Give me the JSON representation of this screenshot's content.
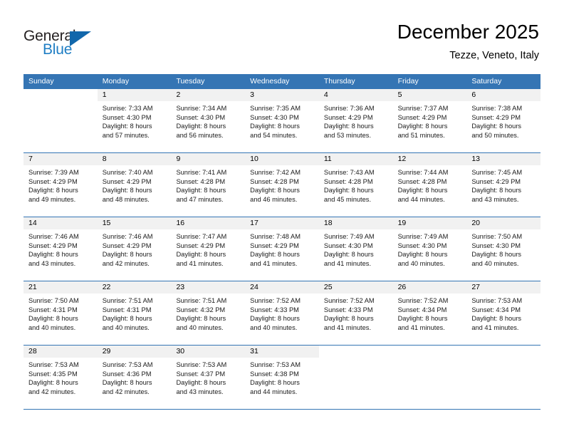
{
  "brand": {
    "name_top": "General",
    "name_bottom": "Blue",
    "color_black": "#231f20",
    "color_blue": "#1f7ec4",
    "triangle_color": "#1267ab"
  },
  "header": {
    "month_title": "December 2025",
    "location": "Tezze, Veneto, Italy"
  },
  "calendar": {
    "accent_color": "#3575b4",
    "daynum_band_color": "#f1f1f1",
    "weekdays": [
      "Sunday",
      "Monday",
      "Tuesday",
      "Wednesday",
      "Thursday",
      "Friday",
      "Saturday"
    ],
    "weeks": [
      [
        {
          "day": "",
          "lines": [
            "",
            "",
            "",
            ""
          ]
        },
        {
          "day": "1",
          "lines": [
            "Sunrise: 7:33 AM",
            "Sunset: 4:30 PM",
            "Daylight: 8 hours",
            "and 57 minutes."
          ]
        },
        {
          "day": "2",
          "lines": [
            "Sunrise: 7:34 AM",
            "Sunset: 4:30 PM",
            "Daylight: 8 hours",
            "and 56 minutes."
          ]
        },
        {
          "day": "3",
          "lines": [
            "Sunrise: 7:35 AM",
            "Sunset: 4:30 PM",
            "Daylight: 8 hours",
            "and 54 minutes."
          ]
        },
        {
          "day": "4",
          "lines": [
            "Sunrise: 7:36 AM",
            "Sunset: 4:29 PM",
            "Daylight: 8 hours",
            "and 53 minutes."
          ]
        },
        {
          "day": "5",
          "lines": [
            "Sunrise: 7:37 AM",
            "Sunset: 4:29 PM",
            "Daylight: 8 hours",
            "and 51 minutes."
          ]
        },
        {
          "day": "6",
          "lines": [
            "Sunrise: 7:38 AM",
            "Sunset: 4:29 PM",
            "Daylight: 8 hours",
            "and 50 minutes."
          ]
        }
      ],
      [
        {
          "day": "7",
          "lines": [
            "Sunrise: 7:39 AM",
            "Sunset: 4:29 PM",
            "Daylight: 8 hours",
            "and 49 minutes."
          ]
        },
        {
          "day": "8",
          "lines": [
            "Sunrise: 7:40 AM",
            "Sunset: 4:29 PM",
            "Daylight: 8 hours",
            "and 48 minutes."
          ]
        },
        {
          "day": "9",
          "lines": [
            "Sunrise: 7:41 AM",
            "Sunset: 4:28 PM",
            "Daylight: 8 hours",
            "and 47 minutes."
          ]
        },
        {
          "day": "10",
          "lines": [
            "Sunrise: 7:42 AM",
            "Sunset: 4:28 PM",
            "Daylight: 8 hours",
            "and 46 minutes."
          ]
        },
        {
          "day": "11",
          "lines": [
            "Sunrise: 7:43 AM",
            "Sunset: 4:28 PM",
            "Daylight: 8 hours",
            "and 45 minutes."
          ]
        },
        {
          "day": "12",
          "lines": [
            "Sunrise: 7:44 AM",
            "Sunset: 4:28 PM",
            "Daylight: 8 hours",
            "and 44 minutes."
          ]
        },
        {
          "day": "13",
          "lines": [
            "Sunrise: 7:45 AM",
            "Sunset: 4:29 PM",
            "Daylight: 8 hours",
            "and 43 minutes."
          ]
        }
      ],
      [
        {
          "day": "14",
          "lines": [
            "Sunrise: 7:46 AM",
            "Sunset: 4:29 PM",
            "Daylight: 8 hours",
            "and 43 minutes."
          ]
        },
        {
          "day": "15",
          "lines": [
            "Sunrise: 7:46 AM",
            "Sunset: 4:29 PM",
            "Daylight: 8 hours",
            "and 42 minutes."
          ]
        },
        {
          "day": "16",
          "lines": [
            "Sunrise: 7:47 AM",
            "Sunset: 4:29 PM",
            "Daylight: 8 hours",
            "and 41 minutes."
          ]
        },
        {
          "day": "17",
          "lines": [
            "Sunrise: 7:48 AM",
            "Sunset: 4:29 PM",
            "Daylight: 8 hours",
            "and 41 minutes."
          ]
        },
        {
          "day": "18",
          "lines": [
            "Sunrise: 7:49 AM",
            "Sunset: 4:30 PM",
            "Daylight: 8 hours",
            "and 41 minutes."
          ]
        },
        {
          "day": "19",
          "lines": [
            "Sunrise: 7:49 AM",
            "Sunset: 4:30 PM",
            "Daylight: 8 hours",
            "and 40 minutes."
          ]
        },
        {
          "day": "20",
          "lines": [
            "Sunrise: 7:50 AM",
            "Sunset: 4:30 PM",
            "Daylight: 8 hours",
            "and 40 minutes."
          ]
        }
      ],
      [
        {
          "day": "21",
          "lines": [
            "Sunrise: 7:50 AM",
            "Sunset: 4:31 PM",
            "Daylight: 8 hours",
            "and 40 minutes."
          ]
        },
        {
          "day": "22",
          "lines": [
            "Sunrise: 7:51 AM",
            "Sunset: 4:31 PM",
            "Daylight: 8 hours",
            "and 40 minutes."
          ]
        },
        {
          "day": "23",
          "lines": [
            "Sunrise: 7:51 AM",
            "Sunset: 4:32 PM",
            "Daylight: 8 hours",
            "and 40 minutes."
          ]
        },
        {
          "day": "24",
          "lines": [
            "Sunrise: 7:52 AM",
            "Sunset: 4:33 PM",
            "Daylight: 8 hours",
            "and 40 minutes."
          ]
        },
        {
          "day": "25",
          "lines": [
            "Sunrise: 7:52 AM",
            "Sunset: 4:33 PM",
            "Daylight: 8 hours",
            "and 41 minutes."
          ]
        },
        {
          "day": "26",
          "lines": [
            "Sunrise: 7:52 AM",
            "Sunset: 4:34 PM",
            "Daylight: 8 hours",
            "and 41 minutes."
          ]
        },
        {
          "day": "27",
          "lines": [
            "Sunrise: 7:53 AM",
            "Sunset: 4:34 PM",
            "Daylight: 8 hours",
            "and 41 minutes."
          ]
        }
      ],
      [
        {
          "day": "28",
          "lines": [
            "Sunrise: 7:53 AM",
            "Sunset: 4:35 PM",
            "Daylight: 8 hours",
            "and 42 minutes."
          ]
        },
        {
          "day": "29",
          "lines": [
            "Sunrise: 7:53 AM",
            "Sunset: 4:36 PM",
            "Daylight: 8 hours",
            "and 42 minutes."
          ]
        },
        {
          "day": "30",
          "lines": [
            "Sunrise: 7:53 AM",
            "Sunset: 4:37 PM",
            "Daylight: 8 hours",
            "and 43 minutes."
          ]
        },
        {
          "day": "31",
          "lines": [
            "Sunrise: 7:53 AM",
            "Sunset: 4:38 PM",
            "Daylight: 8 hours",
            "and 44 minutes."
          ]
        },
        {
          "day": "",
          "lines": [
            "",
            "",
            "",
            ""
          ]
        },
        {
          "day": "",
          "lines": [
            "",
            "",
            "",
            ""
          ]
        },
        {
          "day": "",
          "lines": [
            "",
            "",
            "",
            ""
          ]
        }
      ]
    ]
  }
}
